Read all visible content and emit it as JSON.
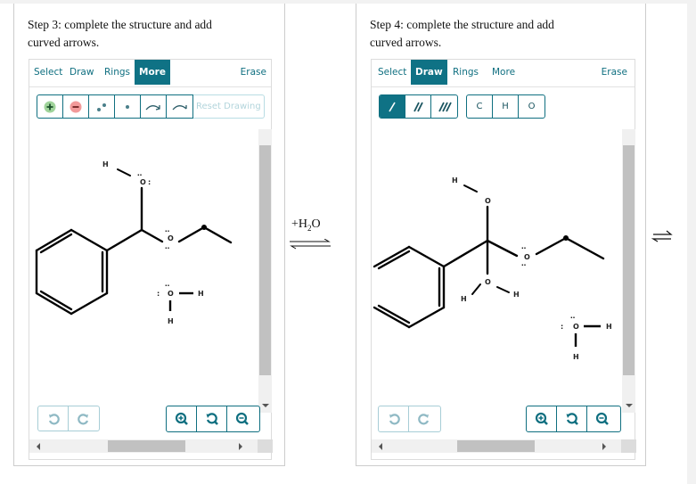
{
  "step3": {
    "title_line1": "Step 3: complete the structure and add",
    "title_line2": "curved arrows.",
    "tabs": [
      "Select",
      "Draw",
      "Rings",
      "More"
    ],
    "active_tab": "More",
    "erase_label": "Erase",
    "tools": [
      "add-charge",
      "remove-charge",
      "lone-pair",
      "radical",
      "curved-arrow-electron-pair",
      "curved-arrow-single-electron"
    ],
    "reset_label": "Reset Drawing",
    "molecule": {
      "atoms": [
        "H",
        "O",
        "O",
        "O",
        "H",
        "H"
      ],
      "description": "Protonated hemiacetal intermediate (Ph-CH(OH)-O-Et) with separate water molecule"
    }
  },
  "reaction": {
    "reagent_prefix": "+H",
    "reagent_subscript": "2",
    "reagent_suffix": "O",
    "equilibrium_icon": "equilibrium-arrow-icon"
  },
  "step4": {
    "title_line1": "Step 4: complete the structure and add",
    "title_line2": "curved arrows.",
    "tabs": [
      "Select",
      "Draw",
      "Rings",
      "More"
    ],
    "active_tab": "Draw",
    "erase_label": "Erase",
    "bond_tools": [
      "single-bond",
      "double-bond",
      "triple-bond"
    ],
    "active_bond": "single-bond",
    "atom_tools": [
      "C",
      "H",
      "O"
    ],
    "molecule": {
      "atoms": [
        "H",
        "O",
        "O",
        "O",
        "H",
        "H",
        "O",
        "H",
        "H"
      ],
      "description": "Tetrahedral intermediate Ph-C(OH)(OH)-O-Et with separate water molecule"
    }
  },
  "right_edge": {
    "equilibrium_icon": "equilibrium-arrow-icon"
  }
}
